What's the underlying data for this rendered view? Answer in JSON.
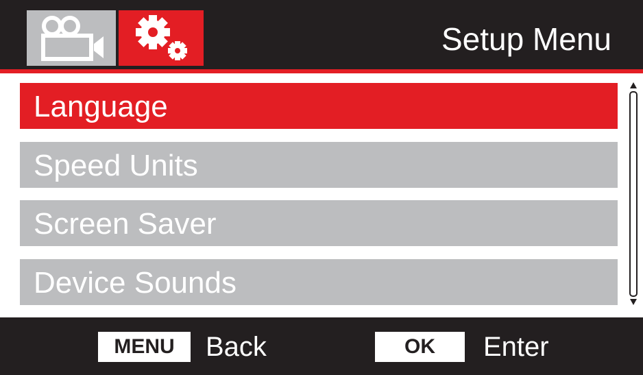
{
  "header": {
    "title": "Setup Menu",
    "tabs": [
      {
        "icon": "video-camera-icon",
        "active": false
      },
      {
        "icon": "gears-icon",
        "active": true
      }
    ]
  },
  "menu": {
    "items": [
      {
        "label": "Language",
        "selected": true
      },
      {
        "label": "Speed Units",
        "selected": false
      },
      {
        "label": "Screen Saver",
        "selected": false
      },
      {
        "label": "Device Sounds",
        "selected": false
      }
    ]
  },
  "footer": {
    "menu_key": "MENU",
    "menu_action": "Back",
    "ok_key": "OK",
    "ok_action": "Enter"
  },
  "colors": {
    "accent": "#e31e24",
    "header_bg": "#231f20",
    "item_bg": "#bcbdbf",
    "text": "#ffffff"
  }
}
